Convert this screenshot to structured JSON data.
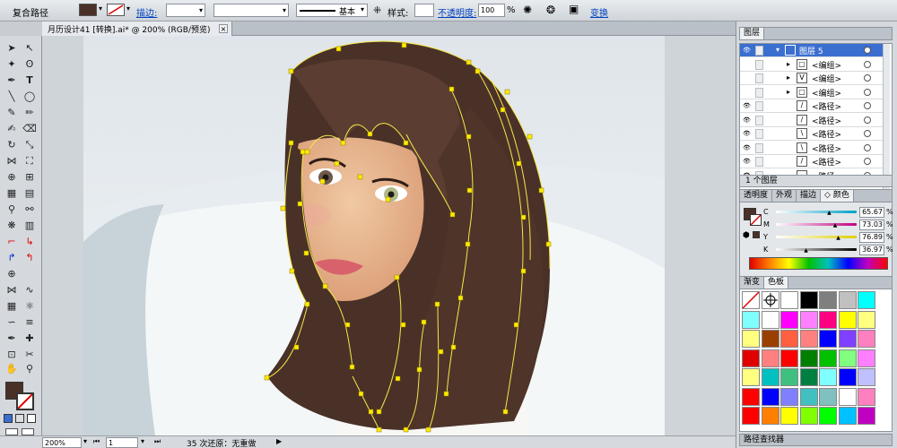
{
  "control_bar": {
    "selection_type": "复合路径",
    "stroke_label": "描边:",
    "stroke_style_label": "基本",
    "style_label": "样式:",
    "opacity_label": "不透明度:",
    "opacity_value": "100",
    "opacity_unit": "%",
    "transform_label": "变换",
    "fill_color": "#4a3128"
  },
  "document_tab": {
    "title": "月历设计41 [转换].ai* @ 200% (RGB/预览)",
    "close": "×"
  },
  "status_bar": {
    "zoom": "200%",
    "page": "1",
    "status_text": "35 次还原：无重做"
  },
  "layers_panel": {
    "tab_label": "图层",
    "layer_count": "1 个图层",
    "rows": [
      {
        "name": "图层 5",
        "selected": true,
        "thumb": "icon-square"
      },
      {
        "name": "<编组>",
        "selected": false,
        "thumb": "▢"
      },
      {
        "name": "<编组>",
        "selected": false,
        "thumb": "V"
      },
      {
        "name": "<编组>",
        "selected": false,
        "thumb": "▢"
      },
      {
        "name": "<路径>",
        "selected": false,
        "thumb": "/"
      },
      {
        "name": "<路径>",
        "selected": false,
        "thumb": "/"
      },
      {
        "name": "<路径>",
        "selected": false,
        "thumb": "\\"
      },
      {
        "name": "<路径>",
        "selected": false,
        "thumb": "\\"
      },
      {
        "name": "<路径>",
        "selected": false,
        "thumb": "/"
      },
      {
        "name": "<路径>",
        "selected": false,
        "thumb": ""
      }
    ]
  },
  "color_panel": {
    "tabs": [
      "透明度",
      "外观",
      "描边",
      "颜色"
    ],
    "active_tab": "颜色",
    "channels": [
      {
        "label": "C",
        "value": "65.67",
        "unit": "%",
        "level": 0.6567
      },
      {
        "label": "M",
        "value": "73.03",
        "unit": "%",
        "level": 0.7303
      },
      {
        "label": "Y",
        "value": "76.89",
        "unit": "%",
        "level": 0.7689
      },
      {
        "label": "K",
        "value": "36.97",
        "unit": "%",
        "level": 0.3697
      }
    ],
    "fill_color": "#4a3128"
  },
  "swatches_panel": {
    "tabs": [
      "渐变",
      "色板"
    ],
    "active_tab": "色板",
    "colors": [
      "none",
      "registration",
      "#ffffff",
      "#000000",
      "#7f7f7f",
      "#c0c0c0",
      "#00ffff",
      "#80ffff",
      "#ffffff",
      "#ff00ff",
      "#ff80ff",
      "#ff0080",
      "#ffff00",
      "#ffff80",
      "#ffff80",
      "#994000",
      "#ff6040",
      "#ff8080",
      "#0000ff",
      "#8040ff",
      "#ff80c0",
      "#e00000",
      "#ff8080",
      "#ff0000",
      "#008000",
      "#00c000",
      "#80ff80",
      "#ff80ff",
      "#ffff80",
      "#00c0c0",
      "#40c080",
      "#008040",
      "#80ffff",
      "#0000ff",
      "#c0c0ff",
      "#ff0000",
      "#0000ff",
      "#8080ff",
      "#40c0c0",
      "#80c0c0",
      "#ffffff",
      "#ff80c0",
      "#ff0000",
      "#ff8000",
      "#ffff00",
      "#80ff00",
      "#00ff00",
      "#00c0ff",
      "#c000c0"
    ]
  },
  "bottom_tabs": {
    "path_label": "路径查找器"
  }
}
